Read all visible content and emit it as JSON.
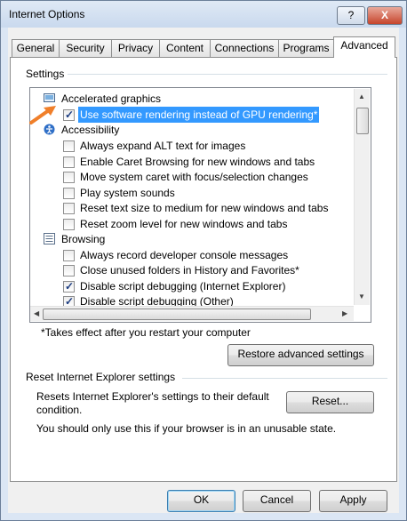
{
  "window": {
    "title": "Internet Options",
    "help_label": "?",
    "close_label": "X"
  },
  "tabs": [
    {
      "label": "General"
    },
    {
      "label": "Security"
    },
    {
      "label": "Privacy"
    },
    {
      "label": "Content"
    },
    {
      "label": "Connections"
    },
    {
      "label": "Programs"
    },
    {
      "label": "Advanced"
    }
  ],
  "active_tab": "Advanced",
  "settings": {
    "group_label": "Settings",
    "rows": [
      {
        "type": "category",
        "icon": "monitor-icon",
        "label": "Accelerated graphics"
      },
      {
        "type": "checkbox",
        "checked": true,
        "selected": true,
        "label": "Use software rendering instead of GPU rendering*"
      },
      {
        "type": "category",
        "icon": "accessibility-icon",
        "label": "Accessibility"
      },
      {
        "type": "checkbox",
        "checked": false,
        "label": "Always expand ALT text for images"
      },
      {
        "type": "checkbox",
        "checked": false,
        "label": "Enable Caret Browsing for new windows and tabs"
      },
      {
        "type": "checkbox",
        "checked": false,
        "label": "Move system caret with focus/selection changes"
      },
      {
        "type": "checkbox",
        "checked": false,
        "label": "Play system sounds"
      },
      {
        "type": "checkbox",
        "checked": false,
        "label": "Reset text size to medium for new windows and tabs"
      },
      {
        "type": "checkbox",
        "checked": false,
        "label": "Reset zoom level for new windows and tabs"
      },
      {
        "type": "category",
        "icon": "browsing-icon",
        "label": "Browsing"
      },
      {
        "type": "checkbox",
        "checked": false,
        "label": "Always record developer console messages"
      },
      {
        "type": "checkbox",
        "checked": false,
        "label": "Close unused folders in History and Favorites*"
      },
      {
        "type": "checkbox",
        "checked": true,
        "label": "Disable script debugging (Internet Explorer)"
      },
      {
        "type": "checkbox",
        "checked": true,
        "label": "Disable script debugging (Other)"
      }
    ],
    "footnote": "*Takes effect after you restart your computer",
    "restore_label": "Restore advanced settings"
  },
  "reset": {
    "group_label": "Reset Internet Explorer settings",
    "description_line1": "Resets Internet Explorer's settings to their default",
    "description_line2": "condition.",
    "reset_label": "Reset...",
    "warning": "You should only use this if your browser is in an unusable state."
  },
  "footer": {
    "ok_label": "OK",
    "cancel_label": "Cancel",
    "apply_label": "Apply"
  },
  "colors": {
    "selection": "#3399ff",
    "annotation_arrow": "#f07f2a"
  }
}
